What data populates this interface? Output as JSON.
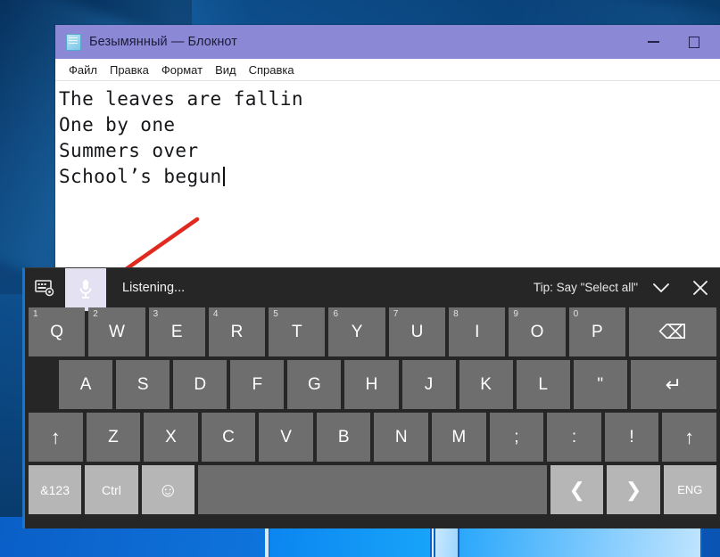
{
  "desktop": {
    "name": "windows-desktop"
  },
  "notepad": {
    "icon": "notepad-document-icon",
    "title": "Безымянный — Блокнот",
    "window_controls": {
      "minimize": "−",
      "maximize": "□"
    },
    "menu": [
      "Файл",
      "Правка",
      "Формат",
      "Вид",
      "Справка"
    ],
    "text_lines": [
      "The leaves are fallin",
      "One by one",
      "Summers over",
      "School’s begun"
    ]
  },
  "annotation": {
    "arrow": "red-pointer-arrow",
    "color": "#e02a20"
  },
  "voice_keyboard": {
    "toolbar": {
      "settings_icon": "keyboard-settings-icon",
      "mic_icon": "microphone-icon",
      "status": "Listening...",
      "tip": "Tip: Say \"Select all\"",
      "chevron_icon": "chevron-down-icon",
      "close_icon": "close-icon",
      "mic_active_color": "#e4e2f2"
    },
    "rows": [
      [
        {
          "label": "Q",
          "sup": "1"
        },
        {
          "label": "W",
          "sup": "2"
        },
        {
          "label": "E",
          "sup": "3"
        },
        {
          "label": "R",
          "sup": "4"
        },
        {
          "label": "T",
          "sup": "5"
        },
        {
          "label": "Y",
          "sup": "6"
        },
        {
          "label": "U",
          "sup": "7"
        },
        {
          "label": "I",
          "sup": "8"
        },
        {
          "label": "O",
          "sup": "9"
        },
        {
          "label": "P",
          "sup": "0"
        },
        {
          "label": "⌫",
          "sup": ""
        }
      ],
      [
        {
          "label": "A",
          "sup": ""
        },
        {
          "label": "S",
          "sup": ""
        },
        {
          "label": "D",
          "sup": ""
        },
        {
          "label": "F",
          "sup": ""
        },
        {
          "label": "G",
          "sup": ""
        },
        {
          "label": "H",
          "sup": ""
        },
        {
          "label": "J",
          "sup": ""
        },
        {
          "label": "K",
          "sup": ""
        },
        {
          "label": "L",
          "sup": ""
        },
        {
          "label": "\"",
          "sup": ""
        },
        {
          "label": "↵",
          "sup": ""
        }
      ],
      [
        {
          "label": "↑",
          "sup": ""
        },
        {
          "label": "Z",
          "sup": ""
        },
        {
          "label": "X",
          "sup": ""
        },
        {
          "label": "C",
          "sup": ""
        },
        {
          "label": "V",
          "sup": ""
        },
        {
          "label": "B",
          "sup": ""
        },
        {
          "label": "N",
          "sup": ""
        },
        {
          "label": "M",
          "sup": ""
        },
        {
          "label": ";",
          "sup": ""
        },
        {
          "label": ":",
          "sup": ""
        },
        {
          "label": "!",
          "sup": ""
        },
        {
          "label": "↑",
          "sup": ""
        }
      ],
      [
        {
          "label": "&123",
          "sup": ""
        },
        {
          "label": "Ctrl",
          "sup": ""
        },
        {
          "label": "☺",
          "sup": ""
        },
        {
          "label": "",
          "sup": ""
        },
        {
          "label": "❮",
          "sup": ""
        },
        {
          "label": "❯",
          "sup": ""
        },
        {
          "label": "ENG",
          "sup": ""
        }
      ]
    ]
  }
}
